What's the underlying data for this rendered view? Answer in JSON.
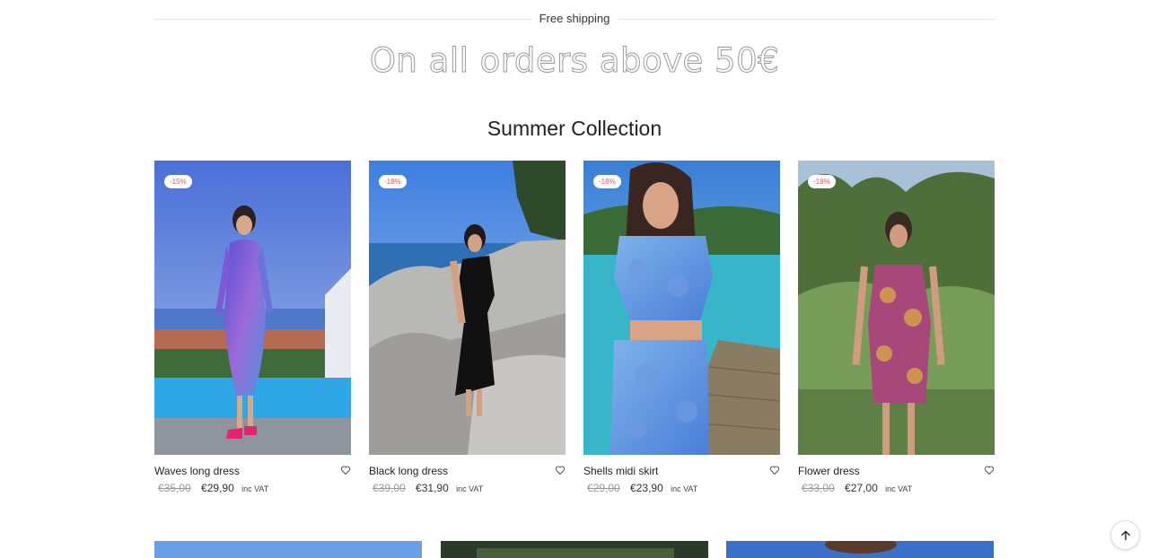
{
  "header": {
    "shipping_label": "Free shipping",
    "promo_text": "On all orders above 50€"
  },
  "section": {
    "title": "Summer Collection"
  },
  "products": [
    {
      "name": "Waves long dress",
      "badge": "-15%",
      "old_price": "€35,00",
      "price": "€29,90",
      "vat": "inc VAT"
    },
    {
      "name": "Black long dress",
      "badge": "-18%",
      "old_price": "€39,00",
      "price": "€31,90",
      "vat": "inc VAT"
    },
    {
      "name": "Shells midi skirt",
      "badge": "-18%",
      "old_price": "€29,00",
      "price": "€23,90",
      "vat": "inc VAT"
    },
    {
      "name": "Flower dress",
      "badge": "-18%",
      "old_price": "€33,00",
      "price": "€27,00",
      "vat": "inc VAT"
    }
  ],
  "icons": {
    "wishlist": "heart-icon",
    "scroll_top": "arrow-up-icon"
  },
  "colors": {
    "badge_text": "#e05a4f",
    "old_price": "#999999",
    "promo_stroke": "#9a9a9a"
  }
}
